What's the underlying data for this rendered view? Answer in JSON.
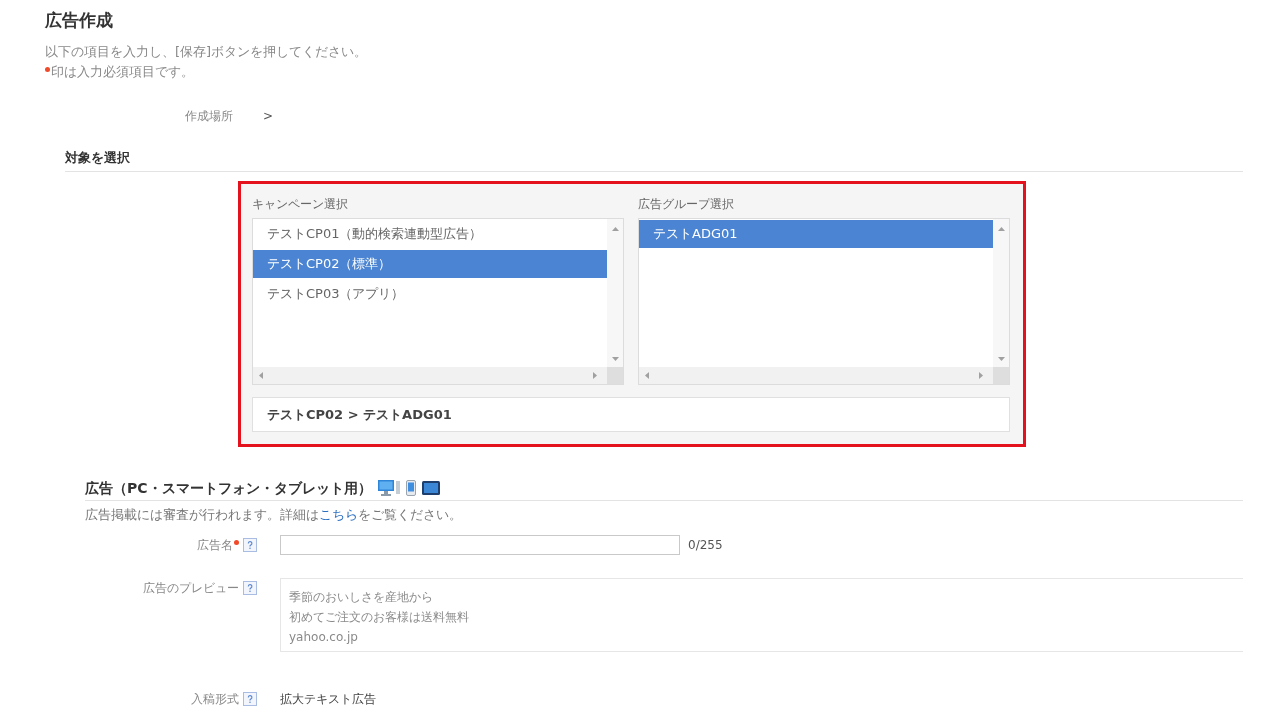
{
  "page": {
    "title": "広告作成",
    "instructions": "以下の項目を入力し、[保存]ボタンを押してください。",
    "required_note": "印は入力必須項目です。"
  },
  "location": {
    "label": "作成場所",
    "value": ">"
  },
  "target_section": {
    "heading": "対象を選択",
    "highlighted": true,
    "campaign_list": {
      "label": "キャンペーン選択",
      "items": [
        {
          "label": "テストCP01（動的検索連動型広告）",
          "selected": false
        },
        {
          "label": "テストCP02（標準）",
          "selected": true
        },
        {
          "label": "テストCP03（アプリ）",
          "selected": false
        }
      ]
    },
    "ad_group_list": {
      "label": "広告グループ選択",
      "items": [
        {
          "label": "テストADG01",
          "selected": true
        }
      ]
    },
    "selection_path": "テストCP02 > テストADG01"
  },
  "ad_section": {
    "heading": "広告（PC・スマートフォン・タブレット用）",
    "notice": {
      "text": "広告掲載には審査が行われます。詳細は",
      "link": "こちら",
      "text_after": "をご覧ください。"
    },
    "fields": [
      {
        "kind": "text_input",
        "label": "広告名",
        "required": true,
        "counter": "0/255"
      },
      {
        "kind": "preview",
        "label": "広告のプレビュー",
        "required": false,
        "lines": [
          "季節のおいしさを産地から",
          "初めてご注文のお客様は送料無料",
          "yahoo.co.jp"
        ]
      },
      {
        "kind": "static",
        "label": "入稿形式",
        "required": false,
        "value": "拡大テキスト広告"
      }
    ]
  }
}
